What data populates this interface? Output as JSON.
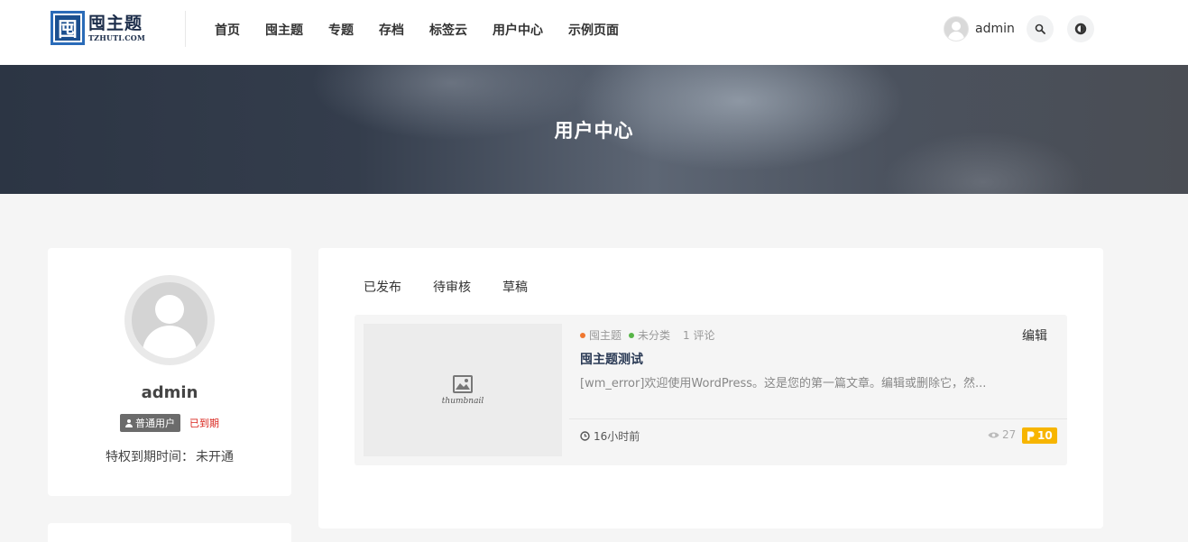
{
  "header": {
    "logo": {
      "mark": "囤",
      "title": "囤主题",
      "subtitle": "TZHUTI.COM"
    },
    "nav": [
      "首页",
      "囤主题",
      "专题",
      "存档",
      "标签云",
      "用户中心",
      "示例页面"
    ],
    "user": {
      "name": "admin",
      "icon": "avatar-icon"
    },
    "search_icon": "search-icon",
    "theme_icon": "theme-toggle-icon"
  },
  "hero": {
    "title": "用户中心"
  },
  "profile": {
    "name": "admin",
    "role": "普通用户",
    "status": "已到期",
    "privilege_label": "特权到期时间：",
    "privilege_value": "未开通"
  },
  "tabs": [
    "已发布",
    "待审核",
    "草稿"
  ],
  "posts": [
    {
      "thumbnail_label": "thumbnail",
      "categories": [
        {
          "name": "囤主题",
          "color": "#f0772f"
        },
        {
          "name": "未分类",
          "color": "#57b547"
        }
      ],
      "comments": "1 评论",
      "edit": "编辑",
      "title": "囤主题测试",
      "excerpt": "[wm_error]欢迎使用WordPress。这是您的第一篇文章。编辑或删除它，然...",
      "time": "16小时前",
      "views": "27",
      "points": "10"
    }
  ],
  "colors": {
    "accent_points": "#f7b500",
    "expired": "#d9251d",
    "role_badge": "#6b6b6b"
  }
}
